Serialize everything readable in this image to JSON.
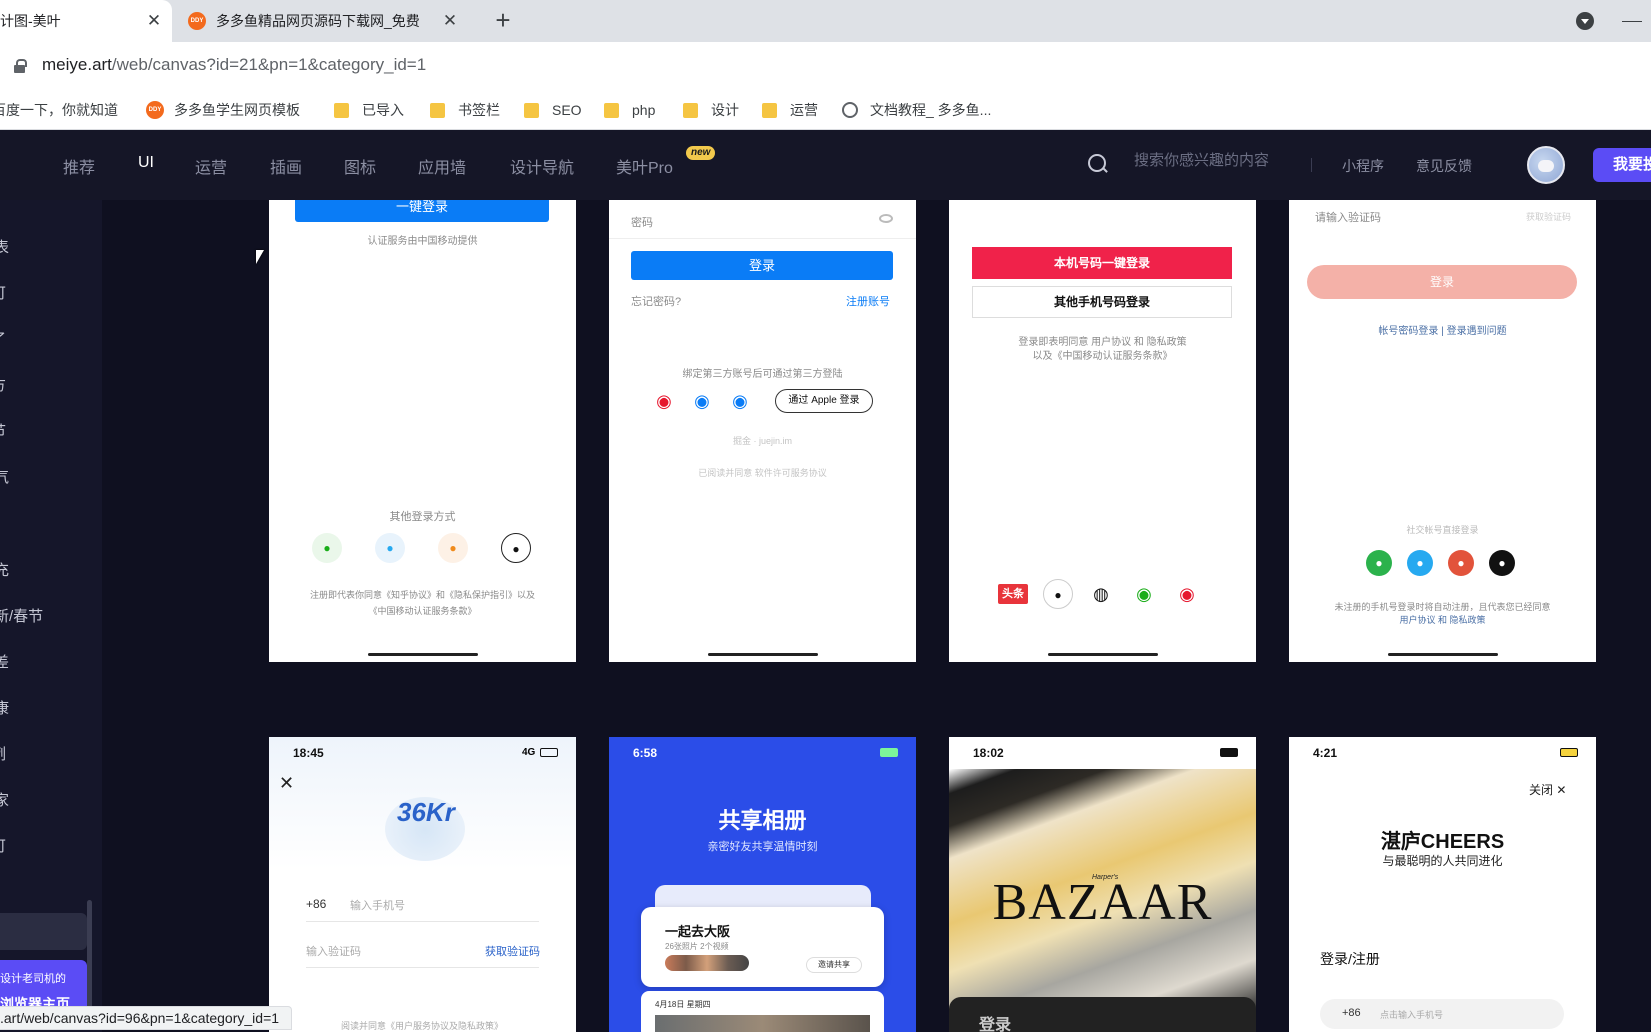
{
  "browser": {
    "tabs": [
      {
        "title": "计图-美叶",
        "close": "✕"
      },
      {
        "title": "多多鱼精品网页源码下载网_免费",
        "icon_text": "DDY",
        "close": "✕"
      }
    ],
    "new_tab": "+",
    "url": {
      "host": "meiye.art",
      "path": "/web/canvas?id=21&pn=1&category_id=1"
    },
    "bookmarks": [
      {
        "label": "百度一下，你就知道",
        "icon": "none"
      },
      {
        "label": "多多鱼学生网页模板",
        "icon": "ddy-icon",
        "icon_text": "DDY"
      },
      {
        "label": "已导入",
        "icon": "folder-icon"
      },
      {
        "label": "书签栏",
        "icon": "folder-icon"
      },
      {
        "label": "SEO",
        "icon": "folder-icon"
      },
      {
        "label": "php",
        "icon": "folder-icon"
      },
      {
        "label": "设计",
        "icon": "folder-icon"
      },
      {
        "label": "运营",
        "icon": "folder-icon"
      },
      {
        "label": "文档教程_ 多多鱼...",
        "icon": "globe-icon"
      }
    ],
    "status_url": ".art/web/canvas?id=96&pn=1&category_id=1"
  },
  "header": {
    "nav": [
      "推荐",
      "UI",
      "运营",
      "插画",
      "图标",
      "应用墙",
      "设计导航",
      "美叶Pro"
    ],
    "active_nav": "UI",
    "new_badge": "new",
    "search_placeholder": "搜索你感兴趣的内容",
    "links": [
      "小程序",
      "意见反馈"
    ],
    "cta": "我要投稿"
  },
  "sidebar": {
    "items": [
      "表",
      "可",
      "了",
      "方",
      "节",
      "气",
      "充",
      "新/春节",
      "差",
      "康",
      "例",
      "家",
      "可"
    ],
    "promo_line1": "设计老司机的",
    "promo_line2": "浏览器主页"
  },
  "cards": {
    "zhihu": {
      "btn": "一键登录",
      "note": "认证服务由中国移动提供",
      "other": "其他登录方式",
      "terms1": "注册即代表你同意《知乎协议》和《隐私保护指引》以及",
      "terms2": "《中国移动认证服务条款》"
    },
    "juejin": {
      "password": "密码",
      "login": "登录",
      "forgot": "忘记密码?",
      "register": "注册账号",
      "third": "绑定第三方账号后可通过第三方登陆",
      "apple": " 通过 Apple 登录",
      "domain": "掘金 · juejin.im",
      "agree": "已阅读并同意 软件许可服务协议"
    },
    "toutiao": {
      "btn1": "本机号码一键登录",
      "btn2": "其他手机号码登录",
      "terms1": "登录即表明同意 用户协议 和 隐私政策",
      "terms2": "以及《中国移动认证服务条款》",
      "brand": "头条"
    },
    "xhs": {
      "code": "请输入验证码",
      "get": "获取验证码",
      "login": "登录",
      "links": "帐号密码登录  |  登录遇到问题",
      "social": "社交帐号直接登录",
      "terms1": "未注册的手机号登录时将自动注册，且代表您已经同意",
      "terms2": "用户协议 和 隐私政策"
    },
    "kr36": {
      "time": "18:45",
      "net": "4G",
      "logo": "36Kr",
      "prefix": "+86",
      "phone": "输入手机号",
      "code": "输入验证码",
      "get": "获取验证码",
      "terms": "阅读并同意《用户服务协议及隐私政策》"
    },
    "album": {
      "time": "6:58",
      "title": "共享相册",
      "sub": "亲密好友共享温情时刻",
      "card_title": "一起去大阪",
      "card_sub": "26张照片 2个视频",
      "invite": "邀请共享",
      "date": "4月18日 星期四"
    },
    "bazaar": {
      "time": "18:02",
      "small": "Harper's",
      "logo": "BAZAAR",
      "login": "登录"
    },
    "cheers": {
      "time": "4:21",
      "close": "关闭 ✕",
      "logo": "湛庐CHEERS",
      "slogan": "与最聪明的人共同进化",
      "login": "登录/注册",
      "prefix": "+86",
      "phone": "点击输入手机号"
    }
  },
  "colors": {
    "page_bg": "#0f1020",
    "header_bg": "#151627",
    "accent": "#5b4cf5",
    "blue_btn": "#0a7cf6",
    "red_btn": "#f0224a",
    "pink_btn": "#f4b1a8",
    "album_bg": "#2b4de8"
  }
}
